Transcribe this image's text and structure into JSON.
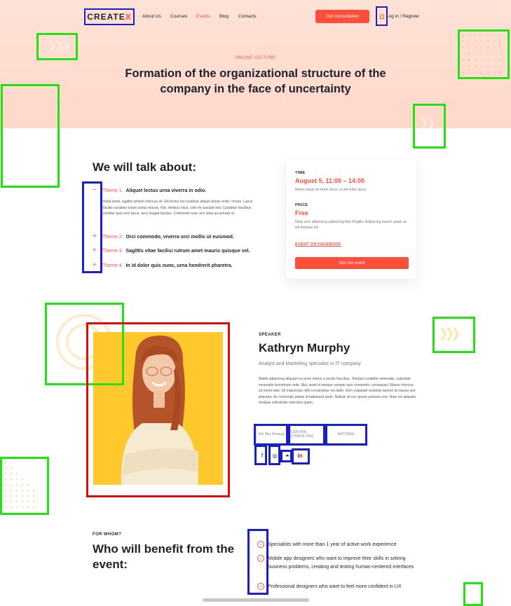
{
  "header": {
    "logo_main": "CREATE",
    "logo_x": "X",
    "nav": [
      "About Us",
      "Courses",
      "Events",
      "Blog",
      "Contacts"
    ],
    "active_nav": "Events",
    "cta": "Get consultation",
    "login": "Log in / Register"
  },
  "hero": {
    "eyebrow": "ONLINE LECTURE",
    "title": "Formation of the organizational structure of the company in the face of uncertainty"
  },
  "talk": {
    "title": "We will talk about:",
    "themes": [
      {
        "toggle": "−",
        "num": "Theme 1.",
        "text": "Aliquet lectus urna viverra in odio."
      },
      {
        "toggle": "+",
        "num": "Theme 2.",
        "text": "Orci commodo, viverra orci mollis ut euismod."
      },
      {
        "toggle": "+",
        "num": "Theme 3.",
        "text": "Sagittis vitae facilisi rutrum amet mauris quisque vel."
      },
      {
        "toggle": "+",
        "num": "Theme 4.",
        "text": "In id dolor quis nunc, urna hendrerit pharetra."
      }
    ],
    "theme1_desc": "Nulla amet, sagittis potenti rhoncus sit. Elit lectus nec pulvinar aliquet donec enim, ornare. Lacus facilisi curabitur turpis varius mauris. Nisi, tempus risus, odio mi suscipit sed. Curabitur faucibus porttitor quis sem lacus, arcu feugiat facilisis. Commodo nunc orci vitae accumsan id."
  },
  "card": {
    "time_label": "TIME",
    "time_value": "August 5, 11:00 – 14:00",
    "time_desc": "Metus turpis sit lorem lacus, in elit tellus lacus.",
    "price_label": "PRICE",
    "price_value": "Free",
    "price_desc": "Nulla sem adipiscing adipiscing felis fringilla. Adipiscing mauris quam ac elit tristique dis.",
    "facebook_link": "EVENT ON FACEBOOK",
    "join": "Join the event"
  },
  "speaker": {
    "eyebrow": "SPEAKER",
    "name": "Kathryn Murphy",
    "role": "Analyst and Marketing specialist in IT company",
    "bio": "Mattis adipiscing aliquam eu proin metus a iaculis faucibus. Tempus curabitur venenatis, vulputate venenatis fermentum ante. Nisl, amet id semper semper quis commodo, consequat. Massa rhoncus sit morbi odio. Sit maecenas nibh consectetur vel diam. Sem vulputate molestie laoreet at massa sed pharetra. Ac commodo platea id habitasse proin. Nullam sit nec ipsum posuere non. Nam vel aliquam tristique sollicitudin interdum quam.",
    "companies": [
      "Del Mar Strategy",
      "CENTRAL CONSULTING",
      "NATIONAL"
    ],
    "socials": [
      "f",
      "◎",
      "❧",
      "in"
    ]
  },
  "who": {
    "eyebrow": "FOR WHOM?",
    "title": "Who will benefit from the event:",
    "benefits": [
      "Specialists with more than 1 year of active work experience",
      "Mobile app designers who want to improve their skills in solving business problems, creating and testing human-centered interfaces",
      "Professional designers who want to feel more confident in UX"
    ]
  }
}
